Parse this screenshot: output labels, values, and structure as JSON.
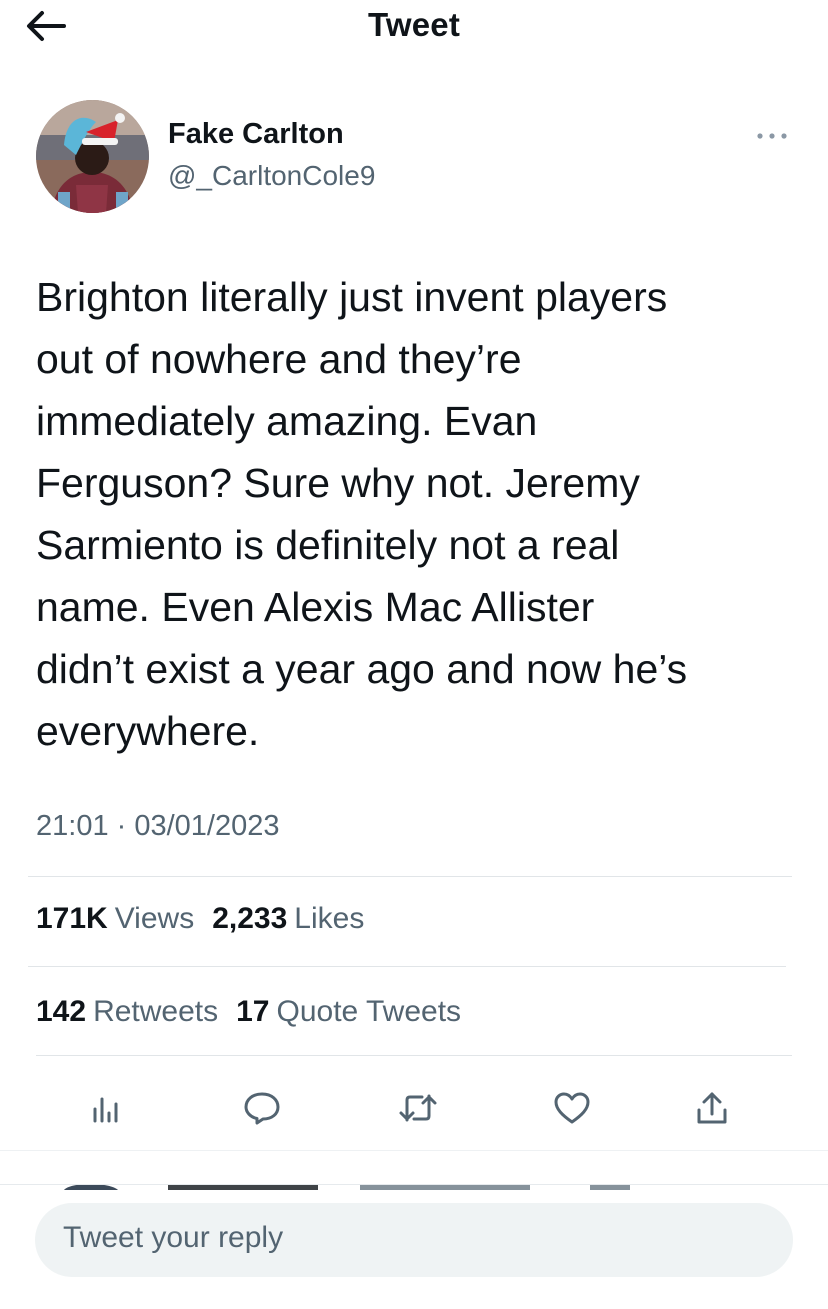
{
  "header": {
    "back_icon": "arrow-left-icon",
    "title": "Tweet"
  },
  "author": {
    "display_name": "Fake Carlton",
    "handle": "@_CarltonCole9",
    "more_icon": "more-horizontal-icon"
  },
  "tweet": {
    "text": "Brighton literally just invent players\nout of nowhere and they’re\nimmediately amazing. Evan\nFerguson? Sure why not. Jeremy\nSarmiento is definitely not a real\nname. Even Alexis Mac Allister\ndidn’t exist a year ago and now he’s\neverywhere.",
    "time": "21:01 · 03/01/2023"
  },
  "stats": {
    "views_count": "171K",
    "views_label": "Views",
    "likes_count": "2,233",
    "likes_label": "Likes",
    "retweets_count": "142",
    "retweets_label": "Retweets",
    "quotes_count": "17",
    "quotes_label": "Quote Tweets"
  },
  "actions": {
    "analytics_icon": "analytics-icon",
    "reply_icon": "reply-icon",
    "retweet_icon": "retweet-icon",
    "like_icon": "heart-icon",
    "share_icon": "share-icon"
  },
  "reply": {
    "placeholder": "Tweet your reply"
  },
  "colors": {
    "text": "#0f1419",
    "secondary": "#536471",
    "divider": "#e1e5e8",
    "reply_bg": "#eff3f4"
  }
}
